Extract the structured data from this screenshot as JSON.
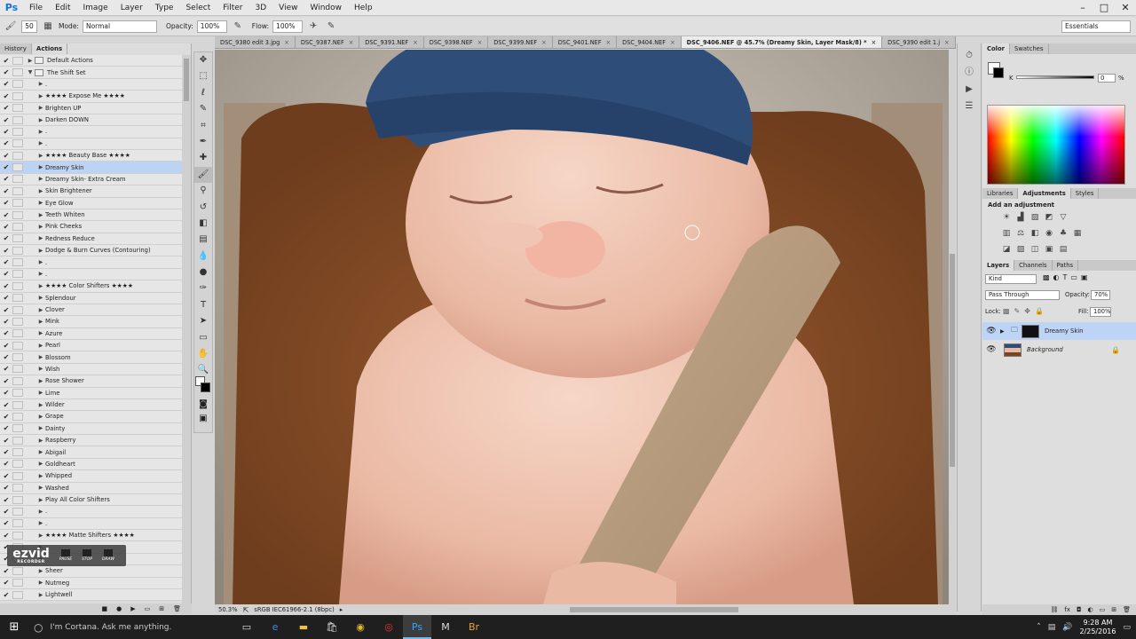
{
  "app": {
    "logo": "Ps"
  },
  "menu": [
    "File",
    "Edit",
    "Image",
    "Layer",
    "Type",
    "Select",
    "Filter",
    "3D",
    "View",
    "Window",
    "Help"
  ],
  "window_controls": {
    "min": "–",
    "max": "□",
    "close": "✕"
  },
  "options": {
    "brush_size": "50",
    "mode_label": "Mode:",
    "mode_value": "Normal",
    "opacity_label": "Opacity:",
    "opacity_value": "100%",
    "flow_label": "Flow:",
    "flow_value": "100%",
    "workspace": "Essentials"
  },
  "left_tabs": [
    "History",
    "Actions"
  ],
  "actions": [
    {
      "check": "✔",
      "dlg": true,
      "tri": "▶",
      "folder": true,
      "label": "Default Actions"
    },
    {
      "check": "✔",
      "dlg": true,
      "tri": "▼",
      "folder": true,
      "label": "The Shift Set"
    },
    {
      "check": "✔",
      "dlg": false,
      "tri": "▶",
      "label": "."
    },
    {
      "check": "✔",
      "dlg": false,
      "tri": "▶",
      "label": "★★★★ Expose Me ★★★★"
    },
    {
      "check": "✔",
      "dlg": false,
      "tri": "▶",
      "label": "Brighten UP"
    },
    {
      "check": "✔",
      "dlg": false,
      "tri": "▶",
      "label": "Darken DOWN"
    },
    {
      "check": "✔",
      "dlg": false,
      "tri": "▶",
      "label": "."
    },
    {
      "check": "✔",
      "dlg": false,
      "tri": "▶",
      "label": "."
    },
    {
      "check": "✔",
      "dlg": false,
      "tri": "▶",
      "label": "★★★★ Beauty Base ★★★★"
    },
    {
      "check": "✔",
      "dlg": false,
      "tri": "▶",
      "label": "Dreamy Skin",
      "selected": true
    },
    {
      "check": "✔",
      "dlg": false,
      "tri": "▶",
      "label": "Dreamy Skin- Extra Cream"
    },
    {
      "check": "✔",
      "dlg": false,
      "tri": "▶",
      "label": "Skin Brightener"
    },
    {
      "check": "✔",
      "dlg": false,
      "tri": "▶",
      "label": "Eye Glow"
    },
    {
      "check": "✔",
      "dlg": false,
      "tri": "▶",
      "label": "Teeth Whiten"
    },
    {
      "check": "✔",
      "dlg": false,
      "tri": "▶",
      "label": "Pink Cheeks"
    },
    {
      "check": "✔",
      "dlg": false,
      "tri": "▶",
      "label": "Redness Reduce"
    },
    {
      "check": "✔",
      "dlg": false,
      "tri": "▶",
      "label": "Dodge & Burn Curves (Contouring)"
    },
    {
      "check": "✔",
      "dlg": false,
      "tri": "▶",
      "label": "."
    },
    {
      "check": "✔",
      "dlg": false,
      "tri": "▶",
      "label": "."
    },
    {
      "check": "✔",
      "dlg": false,
      "tri": "▶",
      "label": "★★★★ Color Shifters ★★★★"
    },
    {
      "check": "✔",
      "dlg": false,
      "tri": "▶",
      "label": "Splendour"
    },
    {
      "check": "✔",
      "dlg": false,
      "tri": "▶",
      "label": "Clover"
    },
    {
      "check": "✔",
      "dlg": false,
      "tri": "▶",
      "label": "Mink"
    },
    {
      "check": "✔",
      "dlg": false,
      "tri": "▶",
      "label": "Azure"
    },
    {
      "check": "✔",
      "dlg": false,
      "tri": "▶",
      "label": "Pearl"
    },
    {
      "check": "✔",
      "dlg": false,
      "tri": "▶",
      "label": "Blossom"
    },
    {
      "check": "✔",
      "dlg": false,
      "tri": "▶",
      "label": "Wish"
    },
    {
      "check": "✔",
      "dlg": false,
      "tri": "▶",
      "label": "Rose Shower"
    },
    {
      "check": "✔",
      "dlg": false,
      "tri": "▶",
      "label": "Lime"
    },
    {
      "check": "✔",
      "dlg": false,
      "tri": "▶",
      "label": "Wilder"
    },
    {
      "check": "✔",
      "dlg": false,
      "tri": "▶",
      "label": "Grape"
    },
    {
      "check": "✔",
      "dlg": true,
      "tri": "▶",
      "label": "Dainty"
    },
    {
      "check": "✔",
      "dlg": false,
      "tri": "▶",
      "label": "Raspberry"
    },
    {
      "check": "✔",
      "dlg": false,
      "tri": "▶",
      "label": "Abigail"
    },
    {
      "check": "✔",
      "dlg": true,
      "tri": "▶",
      "label": "Goldheart"
    },
    {
      "check": "✔",
      "dlg": false,
      "tri": "▶",
      "label": "Whipped"
    },
    {
      "check": "✔",
      "dlg": false,
      "tri": "▶",
      "label": "Washed"
    },
    {
      "check": "✔",
      "dlg": false,
      "tri": "▶",
      "label": "Play All Color Shifters"
    },
    {
      "check": "✔",
      "dlg": false,
      "tri": "▶",
      "label": "."
    },
    {
      "check": "✔",
      "dlg": false,
      "tri": "▶",
      "label": "."
    },
    {
      "check": "✔",
      "dlg": false,
      "tri": "▶",
      "label": "★★★★ Matte Shifters ★★★★"
    },
    {
      "check": "✔",
      "dlg": false,
      "tri": "▶",
      "label": ""
    },
    {
      "check": "✔",
      "dlg": false,
      "tri": "▶",
      "label": ""
    },
    {
      "check": "✔",
      "dlg": false,
      "tri": "▶",
      "label": "Sheer"
    },
    {
      "check": "✔",
      "dlg": false,
      "tri": "▶",
      "label": "Nutmeg"
    },
    {
      "check": "✔",
      "dlg": false,
      "tri": "▶",
      "label": "Lightwell"
    }
  ],
  "action_buttons": [
    "■",
    "●",
    "▶",
    "▭",
    "⊞",
    "🗑"
  ],
  "ezvid": {
    "logo": "ezvid",
    "sub": "RECORDER",
    "pause": "PAUSE",
    "stop": "STOP",
    "draw": "DRAW"
  },
  "doc_tabs": [
    {
      "label": "DSC_9380 edit 3.jpg",
      "active": false
    },
    {
      "label": "DSC_9387.NEF",
      "active": false
    },
    {
      "label": "DSC_9391.NEF",
      "active": false
    },
    {
      "label": "DSC_9398.NEF",
      "active": false
    },
    {
      "label": "DSC_9399.NEF",
      "active": false
    },
    {
      "label": "DSC_9401.NEF",
      "active": false
    },
    {
      "label": "DSC_9404.NEF",
      "active": false
    },
    {
      "label": "DSC_9406.NEF @ 45.7% (Dreamy Skin, Layer Mask/8) *",
      "active": true
    },
    {
      "label": "DSC_9390 edit 1.j",
      "active": false
    }
  ],
  "tab_overflow": "»",
  "status": {
    "zoom": "50.3%",
    "profile": "sRGB IEC61966-2.1 (8bpc)"
  },
  "color_panel": {
    "tabs": [
      "Color",
      "Swatches"
    ],
    "k_label": "K",
    "k_value": "0",
    "k_unit": "%"
  },
  "adjust_panel": {
    "tabs": [
      "Libraries",
      "Adjustments",
      "Styles"
    ],
    "title": "Add an adjustment"
  },
  "layers_panel": {
    "tabs": [
      "Layers",
      "Channels",
      "Paths"
    ],
    "kind": "Kind",
    "blend": "Pass Through",
    "opacity_label": "Opacity:",
    "opacity_value": "70%",
    "lock_label": "Lock:",
    "fill_label": "Fill:",
    "fill_value": "100%",
    "layers": [
      {
        "name": "Dreamy Skin",
        "selected": true
      },
      {
        "name": "Background",
        "selected": false
      }
    ]
  },
  "taskbar": {
    "cortana": "I'm Cortana. Ask me anything.",
    "time": "9:28 AM",
    "date": "2/25/2016"
  },
  "colors": {
    "accent": "#1473d6",
    "selection": "#bcd3f3"
  }
}
